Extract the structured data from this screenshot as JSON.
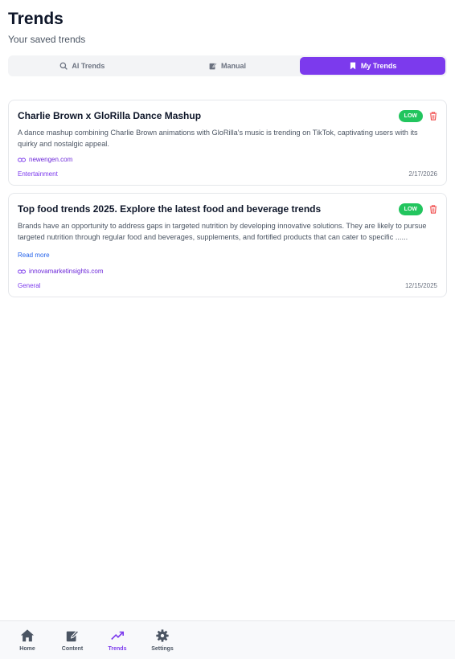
{
  "header": {
    "title": "Trends",
    "subtitle": "Your saved trends"
  },
  "tabs": [
    {
      "label": "AI Trends",
      "icon": "search-icon",
      "active": false
    },
    {
      "label": "Manual",
      "icon": "edit-icon",
      "active": false
    },
    {
      "label": "My Trends",
      "icon": "bookmark-icon",
      "active": true
    }
  ],
  "cards": [
    {
      "title": "Charlie Brown x GloRilla Dance Mashup",
      "badge": "LOW",
      "description": "A dance mashup combining Charlie Brown animations with GloRilla's music is trending on TikTok, captivating users with its quirky and nostalgic appeal.",
      "source": "newengen.com",
      "category": "Entertainment",
      "date": "2/17/2026"
    },
    {
      "title": "Top food trends 2025. Explore the latest food and beverage trends",
      "badge": "LOW",
      "description": "Brands have an opportunity to address gaps in targeted nutrition by developing innovative solutions. They are likely to pursue targeted nutrition through regular food and beverages, supplements, and fortified products that can cater to specific ......",
      "read_more": "Read more",
      "source": "innovamarketinsights.com",
      "category": "General",
      "date": "12/15/2025"
    }
  ],
  "nav": [
    {
      "label": "Home",
      "icon": "home-icon",
      "active": false
    },
    {
      "label": "Content",
      "icon": "edit-icon",
      "active": false
    },
    {
      "label": "Trends",
      "icon": "trending-up-icon",
      "active": true
    },
    {
      "label": "Settings",
      "icon": "gear-icon",
      "active": false
    }
  ],
  "colors": {
    "accent": "#7c3aed",
    "badge": "#22c55e",
    "delete": "#ef4444",
    "link": "#2563eb"
  }
}
